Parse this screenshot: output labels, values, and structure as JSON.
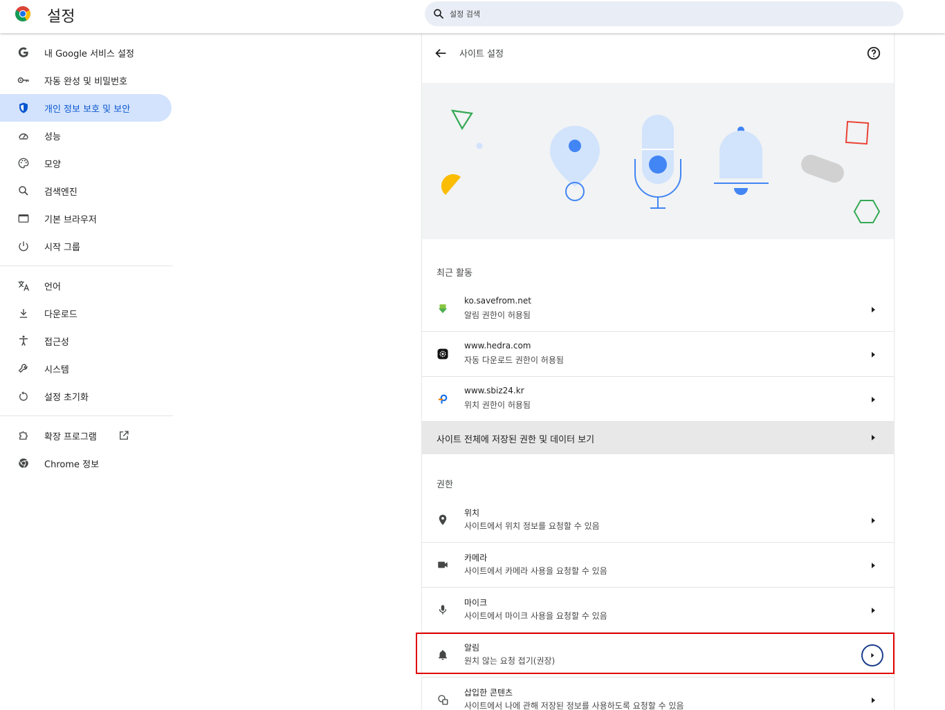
{
  "header": {
    "app_title": "설정",
    "search_placeholder": "설정 검색"
  },
  "sidebar": {
    "items": [
      {
        "label": "내 Google 서비스 설정",
        "icon": "google-g-icon",
        "active": false
      },
      {
        "label": "자동 완성 및 비밀번호",
        "icon": "key-icon",
        "active": false
      },
      {
        "label": "개인 정보 보호 및 보안",
        "icon": "shield-icon",
        "active": true
      },
      {
        "label": "성능",
        "icon": "speedometer-icon",
        "active": false
      },
      {
        "label": "모양",
        "icon": "palette-icon",
        "active": false
      },
      {
        "label": "검색엔진",
        "icon": "search-icon",
        "active": false
      },
      {
        "label": "기본 브라우저",
        "icon": "browser-window-icon",
        "active": false
      },
      {
        "label": "시작 그룹",
        "icon": "power-icon",
        "active": false
      },
      {
        "label": "언어",
        "icon": "translate-icon",
        "active": false
      },
      {
        "label": "다운로드",
        "icon": "download-icon",
        "active": false
      },
      {
        "label": "접근성",
        "icon": "accessibility-icon",
        "active": false
      },
      {
        "label": "시스템",
        "icon": "wrench-icon",
        "active": false
      },
      {
        "label": "설정 초기화",
        "icon": "reset-icon",
        "active": false
      },
      {
        "label": "확장 프로그램",
        "icon": "puzzle-icon",
        "active": false
      },
      {
        "label": "Chrome 정보",
        "icon": "chrome-icon",
        "active": false
      }
    ]
  },
  "main": {
    "title": "사이트 설정",
    "recent": {
      "title": "최근 활동",
      "items": [
        {
          "site": "ko.savefrom.net",
          "detail": "알림 권한이 허용됨",
          "icon": "savefrom-favicon-icon"
        },
        {
          "site": "www.hedra.com",
          "detail": "자동 다운로드 권한이 허용됨",
          "icon": "hedra-favicon-icon"
        },
        {
          "site": "www.sbiz24.kr",
          "detail": "위치 권한이 허용됨",
          "icon": "sbiz24-favicon-icon"
        }
      ]
    },
    "all_sites_label": "사이트 전체에 저장된 권한 및 데이터 보기",
    "permissions": {
      "title": "권한",
      "items": [
        {
          "name": "위치",
          "detail": "사이트에서 위치 정보를 요청할 수 있음",
          "icon": "location-pin-icon"
        },
        {
          "name": "카메라",
          "detail": "사이트에서 카메라 사용을 요청할 수 있음",
          "icon": "camera-icon"
        },
        {
          "name": "마이크",
          "detail": "사이트에서 마이크 사용을 요청할 수 있음",
          "icon": "microphone-icon"
        },
        {
          "name": "알림",
          "detail": "원치 않는 요청 접기(권장)",
          "icon": "bell-icon"
        },
        {
          "name": "삽입한 콘텐츠",
          "detail": "사이트에서 나에 관해 저장된 정보를 사용하도록 요청할 수 있음",
          "icon": "embedded-content-icon"
        }
      ]
    }
  },
  "colors": {
    "accent": "#0b57d0",
    "active_nav_bg": "#d3e3fd",
    "highlight_border": "#e00000",
    "banner_bg": "#f1f3f4"
  }
}
